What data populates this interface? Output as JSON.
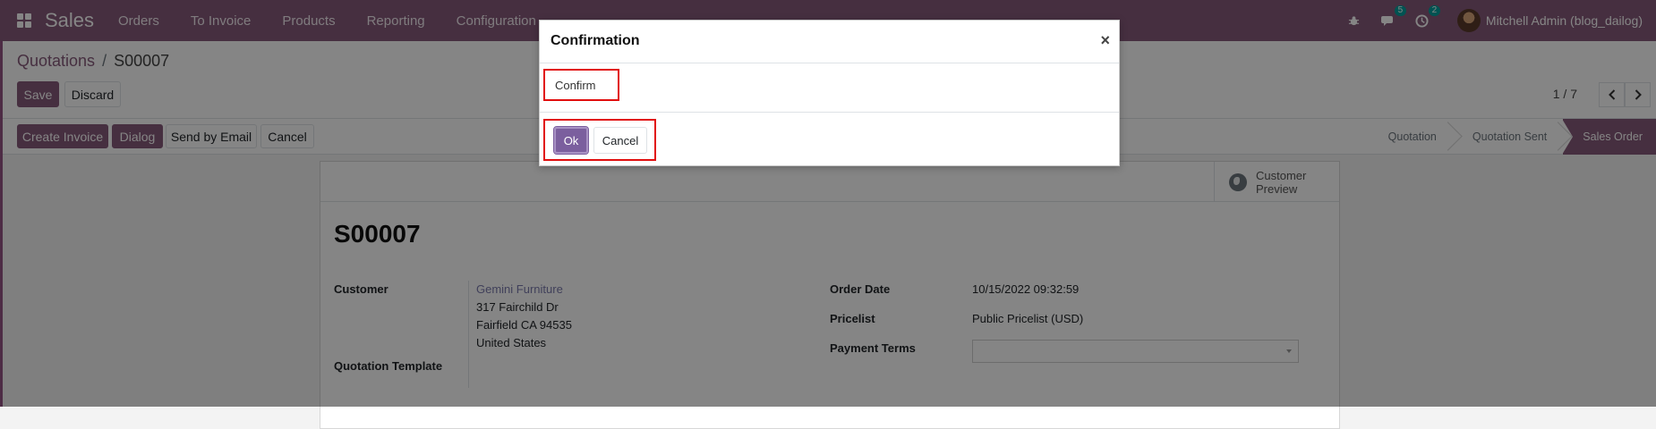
{
  "navbar": {
    "app_name": "Sales",
    "menu": [
      "Orders",
      "To Invoice",
      "Products",
      "Reporting",
      "Configuration"
    ],
    "messages_count": "5",
    "activities_count": "2",
    "user_name": "Mitchell Admin (blog_dailog)",
    "icons": [
      "apps-icon",
      "bug-icon",
      "chat-icon",
      "clock-icon",
      "avatar"
    ],
    "color": "#875a7b"
  },
  "breadcrumb": {
    "parent": "Quotations",
    "separator": "/",
    "current": "S00007"
  },
  "control": {
    "save_label": "Save",
    "discard_label": "Discard",
    "pager_value": "1 / 7"
  },
  "statusbar": {
    "buttons": [
      "Create Invoice",
      "Dialog",
      "Send by Email",
      "Cancel"
    ],
    "stages": [
      "Quotation",
      "Quotation Sent",
      "Sales Order"
    ],
    "active_stage": "Sales Order"
  },
  "form": {
    "smart_button_label": "Customer Preview",
    "title": "S00007",
    "customer_label": "Customer",
    "customer_name": "Gemini Furniture",
    "address_line1": "317 Fairchild Dr",
    "address_line2": "Fairfield CA 94535",
    "address_line3": "United States",
    "quotation_template_label": "Quotation Template",
    "order_date_label": "Order Date",
    "order_date_value": "10/15/2022 09:32:59",
    "pricelist_label": "Pricelist",
    "pricelist_value": "Public Pricelist (USD)",
    "payment_terms_label": "Payment Terms",
    "payment_terms_value": ""
  },
  "dialog": {
    "title": "Confirmation",
    "close_symbol": "×",
    "message": "Confirm",
    "ok_label": "Ok",
    "cancel_label": "Cancel",
    "highlight_color": "#e10e0e"
  }
}
